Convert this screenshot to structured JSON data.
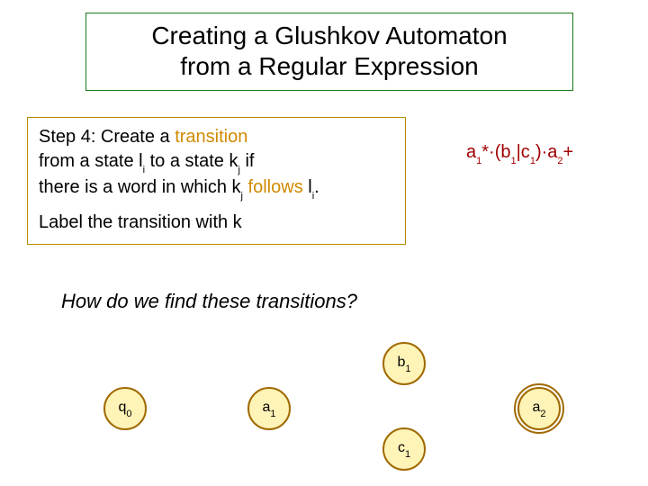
{
  "title": {
    "line1": "Creating a Glushkov Automaton",
    "line2": "from a Regular Expression"
  },
  "step": {
    "prefix1": "Step 4: Create a ",
    "transition_word": "transition",
    "line2a": "from a state l",
    "line2b": " to a state k",
    "line2c": " if",
    "line3a": "there is a word in which k",
    "follows_word": " follows",
    "line3b": " l",
    "line3c": ".",
    "label_line": "Label the transition with k",
    "sub_i": "i",
    "sub_j": "j"
  },
  "regex": {
    "a": "a",
    "one": "1",
    "star_dot_open": "*·(b",
    "pipe_c": "|c",
    "close_dot_a": ")·a",
    "two": "2",
    "plus": "+"
  },
  "question": "How do we find these transitions?",
  "states": {
    "q0": {
      "base": "q",
      "sub": "0"
    },
    "a1": {
      "base": "a",
      "sub": "1"
    },
    "b1": {
      "base": "b",
      "sub": "1"
    },
    "c1": {
      "base": "c",
      "sub": "1"
    },
    "a2": {
      "base": "a",
      "sub": "2"
    }
  }
}
